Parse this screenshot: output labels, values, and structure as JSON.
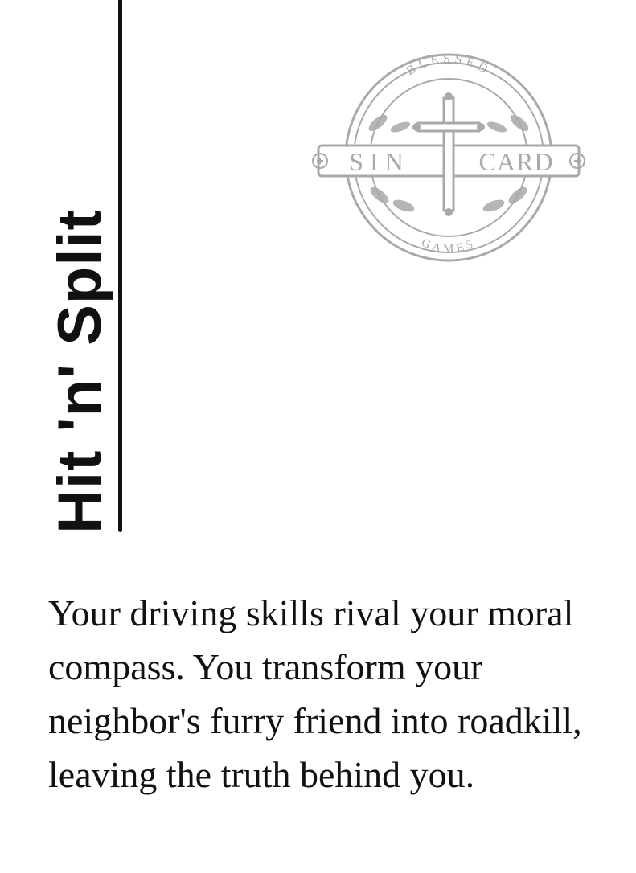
{
  "card": {
    "title": "Hit 'n' Split",
    "description_lines": [
      "Your driving skills rival your moral",
      "compass. You transform your",
      "neighbor's furry friend into roadkill,",
      "leaving the truth behind you."
    ]
  },
  "logo": {
    "top_text": "BLESSED",
    "left_text": "SIN",
    "right_text": "CARD",
    "bottom_text": "GAMES",
    "icon": "cross-seal-icon",
    "color": "#a9a9a9"
  }
}
